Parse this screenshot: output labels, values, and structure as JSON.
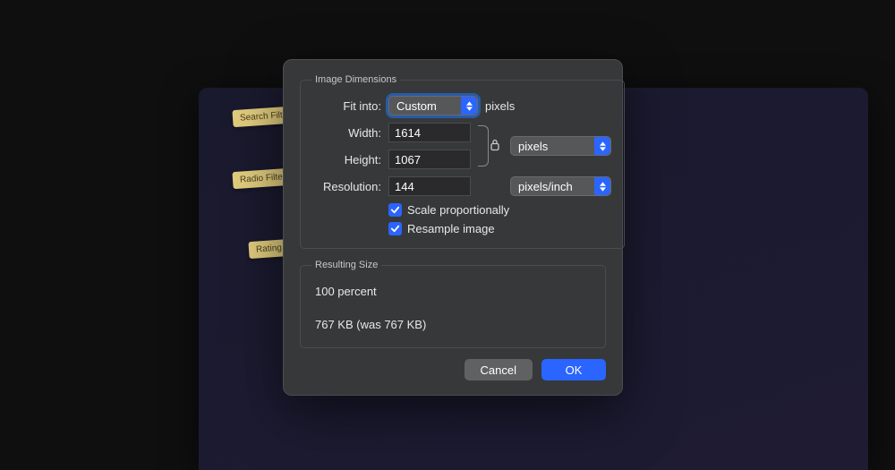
{
  "background": {
    "tags": [
      "Search Filt",
      "Radio Filte",
      "Rating Filt"
    ]
  },
  "dialog": {
    "sections": {
      "dimensions": {
        "legend": "Image Dimensions",
        "fit_into_label": "Fit into:",
        "fit_into_value": "Custom",
        "fit_into_suffix": "pixels",
        "width_label": "Width:",
        "width_value": "1614",
        "height_label": "Height:",
        "height_value": "1067",
        "wh_unit": "pixels",
        "resolution_label": "Resolution:",
        "resolution_value": "144",
        "resolution_unit": "pixels/inch",
        "scale_label": "Scale proportionally",
        "resample_label": "Resample image"
      },
      "result": {
        "legend": "Resulting Size",
        "percent": "100 percent",
        "size": "767 KB (was 767 KB)"
      }
    },
    "buttons": {
      "cancel": "Cancel",
      "ok": "OK"
    }
  }
}
